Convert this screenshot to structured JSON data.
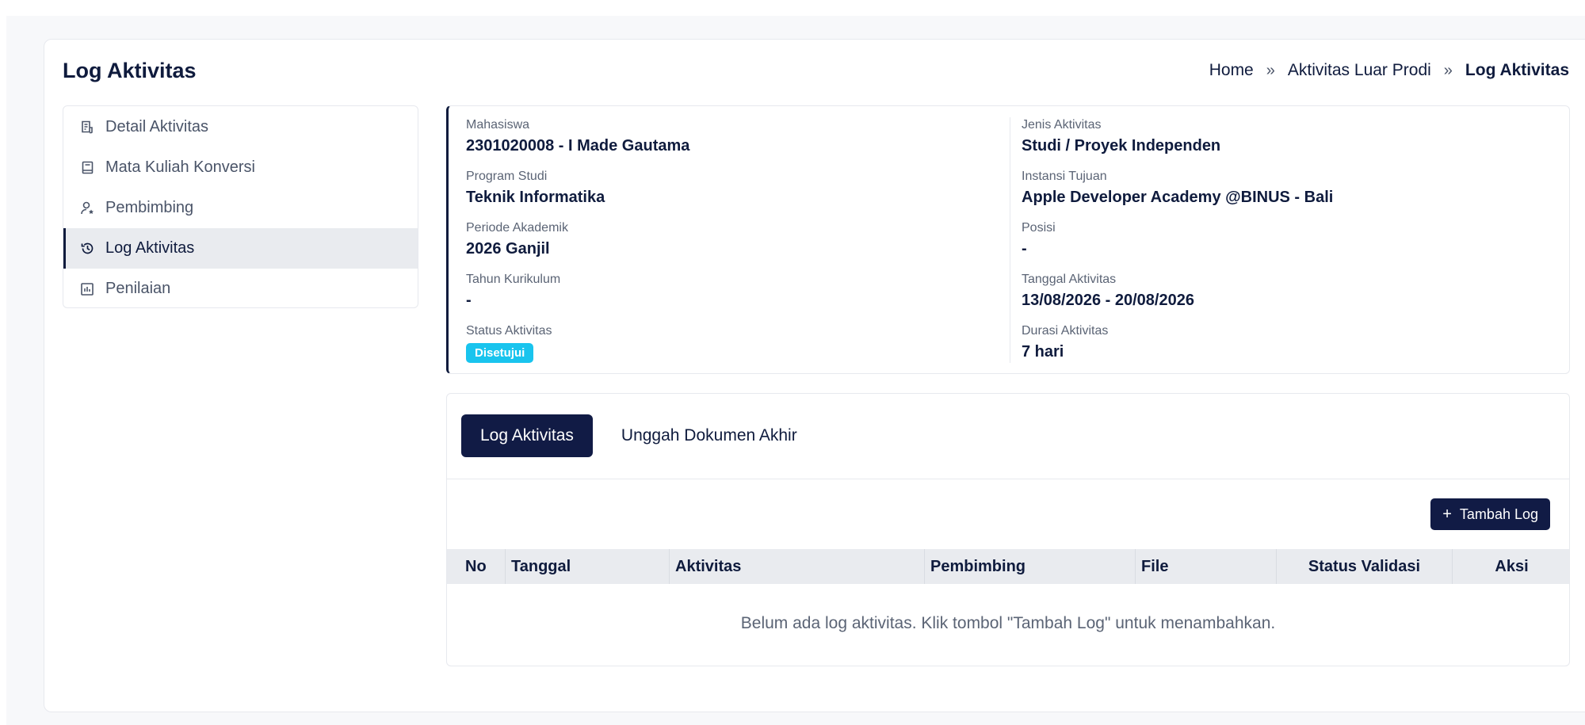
{
  "page": {
    "title": "Log Aktivitas"
  },
  "breadcrumb": {
    "items": [
      "Home",
      "Aktivitas Luar Prodi",
      "Log Aktivitas"
    ],
    "separator": "»"
  },
  "sidebar": {
    "items": [
      {
        "label": "Detail Aktivitas",
        "icon": "document-list-icon",
        "active": false
      },
      {
        "label": "Mata Kuliah Konversi",
        "icon": "book-icon",
        "active": false
      },
      {
        "label": "Pembimbing",
        "icon": "user-star-icon",
        "active": false
      },
      {
        "label": "Log Aktivitas",
        "icon": "history-icon",
        "active": true
      },
      {
        "label": "Penilaian",
        "icon": "bar-chart-icon",
        "active": false
      }
    ]
  },
  "info": {
    "mahasiswa": {
      "label": "Mahasiswa",
      "value": "2301020008 - I Made Gautama"
    },
    "program_studi": {
      "label": "Program Studi",
      "value": "Teknik Informatika"
    },
    "periode": {
      "label": "Periode Akademik",
      "value": "2026 Ganjil"
    },
    "tahun_kurikulum": {
      "label": "Tahun Kurikulum",
      "value": "-"
    },
    "status": {
      "label": "Status Aktivitas",
      "value": "Disetujui",
      "color": "#19c4ee"
    },
    "jenis": {
      "label": "Jenis Aktivitas",
      "value": "Studi / Proyek Independen"
    },
    "instansi": {
      "label": "Instansi Tujuan",
      "value": "Apple Developer Academy @BINUS - Bali"
    },
    "posisi": {
      "label": "Posisi",
      "value": "-"
    },
    "tanggal": {
      "label": "Tanggal Aktivitas",
      "value": "13/08/2026 - 20/08/2026"
    },
    "durasi": {
      "label": "Durasi Aktivitas",
      "value": "7 hari"
    }
  },
  "tabs": {
    "active": "Log Aktivitas",
    "other": "Unggah Dokumen Akhir"
  },
  "actions": {
    "add_label": "Tambah Log",
    "add_icon": "plus-icon"
  },
  "table": {
    "headers": [
      "No",
      "Tanggal",
      "Aktivitas",
      "Pembimbing",
      "File",
      "Status Validasi",
      "Aksi"
    ],
    "empty_message": "Belum ada log aktivitas. Klik tombol \"Tambah Log\" untuk menambahkan."
  },
  "colors": {
    "primary": "#111b45",
    "badge": "#19c4ee",
    "active_bg": "#e9ebef"
  }
}
